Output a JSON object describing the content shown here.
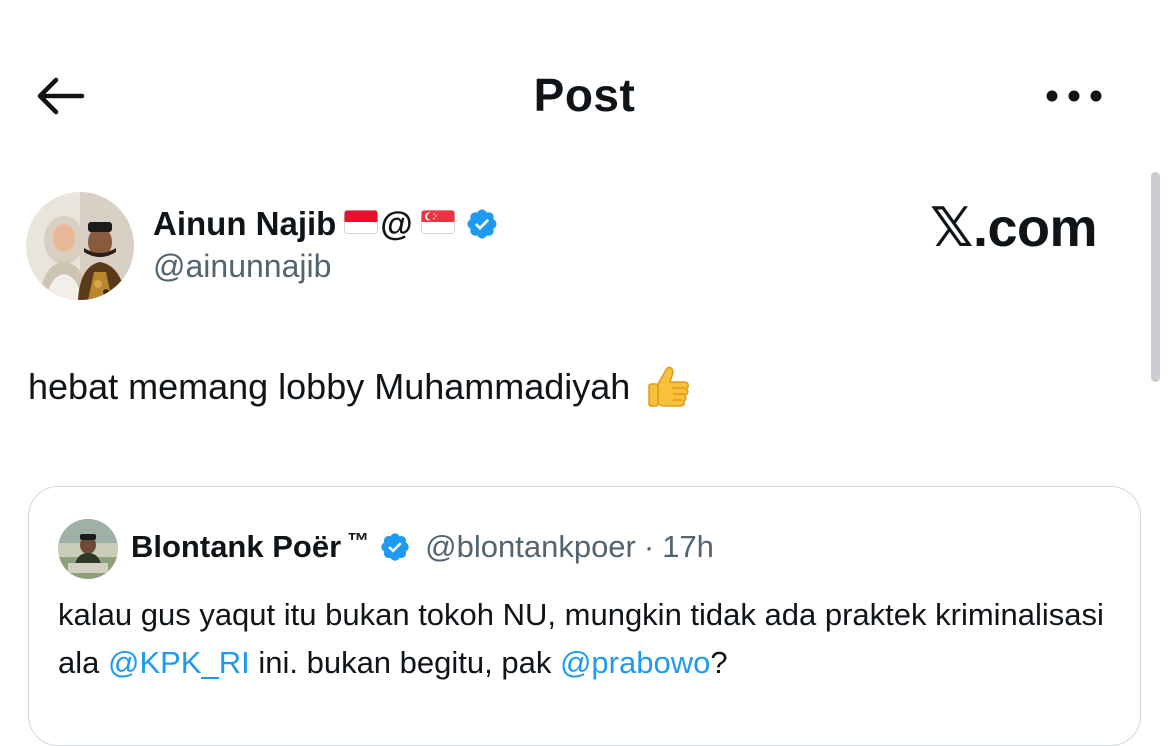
{
  "header": {
    "back_icon": "arrow-left-icon",
    "title": "Post",
    "more_icon": "more-horizontal-icon"
  },
  "watermark": "𝕏.com",
  "author": {
    "name": "Ainun Najib",
    "name_suffix_flags": [
      "indonesia-flag",
      "singapore-flag"
    ],
    "name_at": "@",
    "verified_icon": "verified-badge-icon",
    "handle": "@ainunnajib"
  },
  "tweet": {
    "text": "hebat memang lobby Muhammadiyah",
    "emoji_icon": "thumbs-up-icon"
  },
  "quote": {
    "name": "Blontank Poër",
    "trademark": "™",
    "verified_icon": "verified-badge-icon",
    "handle": "@blontankpoer",
    "separator": "·",
    "time": "17h",
    "text_part1": "kalau gus yaqut itu bukan tokoh NU, mungkin tidak ada praktek kriminalisasi ala ",
    "mention1": "@KPK_RI",
    "text_part2": " ini. bukan begitu, pak ",
    "mention2": "@prabowo",
    "text_part3": "?"
  },
  "colors": {
    "text": "#0f1419",
    "secondary": "#536471",
    "accent": "#1d9bf0",
    "border": "#cfd9de"
  }
}
